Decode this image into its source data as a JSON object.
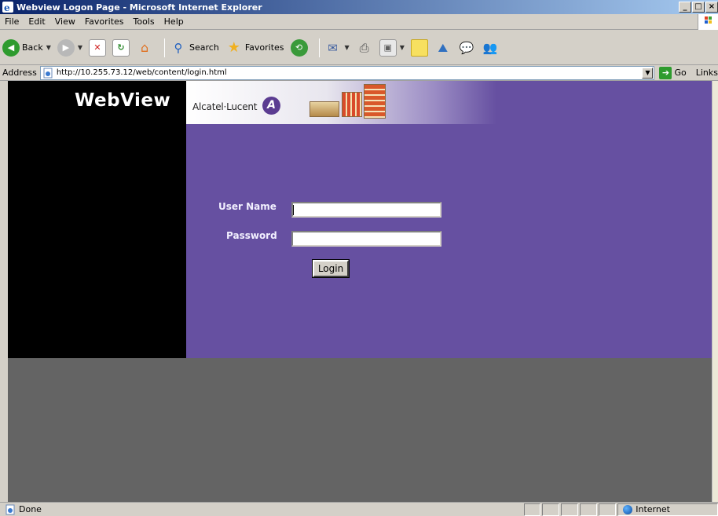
{
  "window": {
    "title": "Webview Logon Page - Microsoft Internet Explorer",
    "controls": [
      "_",
      "□",
      "×"
    ]
  },
  "menu": [
    "File",
    "Edit",
    "View",
    "Favorites",
    "Tools",
    "Help"
  ],
  "toolbar": {
    "back_label": "Back",
    "search_label": "Search",
    "favorites_label": "Favorites"
  },
  "address": {
    "label": "Address",
    "url": "http://10.255.73.12/web/content/login.html",
    "go_label": "Go",
    "links_label": "Links"
  },
  "page": {
    "app_title": "WebView",
    "brand": "Alcatel·Lucent",
    "username_label": "User Name",
    "password_label": "Password",
    "username_value": "",
    "password_value": "",
    "login_button": "Login"
  },
  "status": {
    "text": "Done",
    "zone": "Internet"
  },
  "colors": {
    "left_panel": "#000000",
    "login_panel": "#6650a1",
    "viewport_bg": "#646464"
  }
}
